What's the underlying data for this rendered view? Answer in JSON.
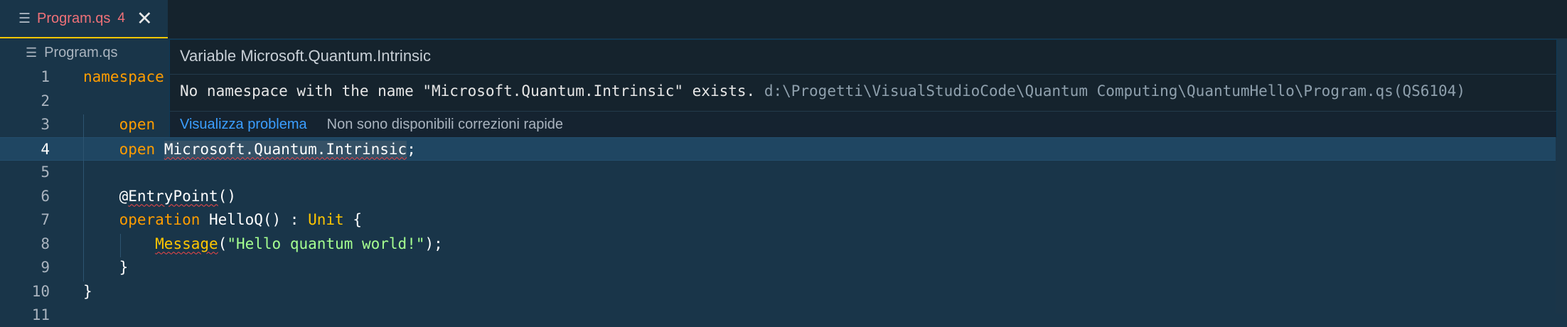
{
  "tab": {
    "name": "Program.qs",
    "badge": "4",
    "close": "✕",
    "icon": "lines-file-icon"
  },
  "breadcrumb": {
    "file": "Program.qs",
    "icon": "lines-file-icon"
  },
  "hover": {
    "signature": "Variable Microsoft.Quantum.Intrinsic",
    "message": "No namespace with the name \"Microsoft.Quantum.Intrinsic\" exists.",
    "source": "d:\\Progetti\\VisualStudioCode\\Quantum Computing\\QuantumHello\\Program.qs(QS6104)",
    "view_problem": "Visualizza problema",
    "no_quick_fix": "Non sono disponibili correzioni rapide"
  },
  "editor": {
    "lines": [
      {
        "n": "1",
        "tokens": [
          [
            "namespace",
            "kw"
          ]
        ]
      },
      {
        "n": "2",
        "tokens": []
      },
      {
        "n": "3",
        "tokens": [
          [
            "    ",
            ""
          ],
          [
            "open",
            "kw"
          ]
        ]
      },
      {
        "n": "4",
        "tokens": [
          [
            "    ",
            ""
          ],
          [
            "open",
            "kw"
          ],
          [
            " ",
            ""
          ],
          [
            "Microsoft.Quantum.Intrinsic",
            "squig hl"
          ],
          [
            ";",
            ""
          ]
        ]
      },
      {
        "n": "5",
        "tokens": []
      },
      {
        "n": "6",
        "tokens": [
          [
            "    ",
            ""
          ],
          [
            "@",
            ""
          ],
          [
            "EntryPoint",
            "squig"
          ],
          [
            "()",
            ""
          ]
        ]
      },
      {
        "n": "7",
        "tokens": [
          [
            "    ",
            ""
          ],
          [
            "operation",
            "kw"
          ],
          [
            " HelloQ() : ",
            "fn"
          ],
          [
            "Unit",
            "ty"
          ],
          [
            " {",
            ""
          ]
        ]
      },
      {
        "n": "8",
        "tokens": [
          [
            "        ",
            ""
          ],
          [
            "Message",
            "call squig"
          ],
          [
            "(",
            ""
          ],
          [
            "\"Hello quantum world!\"",
            "str"
          ],
          [
            ");",
            ""
          ]
        ]
      },
      {
        "n": "9",
        "tokens": [
          [
            "    ",
            ""
          ],
          [
            "}",
            ""
          ]
        ]
      },
      {
        "n": "10",
        "tokens": [
          [
            "}",
            ""
          ]
        ]
      },
      {
        "n": "11",
        "tokens": []
      }
    ],
    "current_line": "4"
  },
  "colors": {
    "background": "#193549",
    "accent": "#ffc600",
    "error": "#f44747",
    "link": "#3b9eff"
  }
}
